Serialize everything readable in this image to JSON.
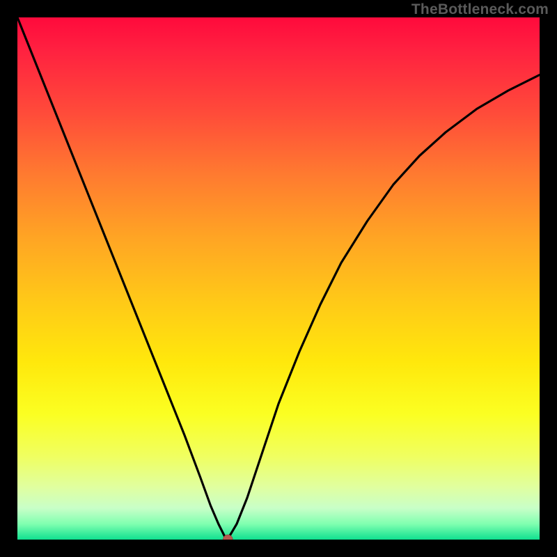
{
  "watermark": "TheBottleneck.com",
  "chart_data": {
    "type": "line",
    "title": "",
    "xlabel": "",
    "ylabel": "",
    "xlim": [
      0,
      100
    ],
    "ylim": [
      0,
      100
    ],
    "grid": false,
    "series": [
      {
        "name": "bottleneck-curve",
        "x": [
          0,
          2,
          5,
          8,
          11,
          14,
          17,
          20,
          23,
          26,
          29,
          32,
          35,
          37,
          38.5,
          39.5,
          40,
          40.7,
          42,
          44,
          47,
          50,
          54,
          58,
          62,
          67,
          72,
          77,
          82,
          88,
          94,
          100
        ],
        "y": [
          100,
          95,
          87.5,
          80,
          72.5,
          65,
          57.5,
          50,
          42.5,
          35,
          27.5,
          20,
          12,
          6.5,
          3,
          1,
          0,
          0.8,
          3,
          8,
          17,
          26,
          36,
          45,
          53,
          61,
          68,
          73.5,
          78,
          82.5,
          86,
          89
        ],
        "color": "#000000"
      }
    ],
    "markers": [
      {
        "name": "min-point",
        "x": 40.3,
        "y": 0,
        "color": "#b75a50",
        "size": 10
      }
    ]
  }
}
